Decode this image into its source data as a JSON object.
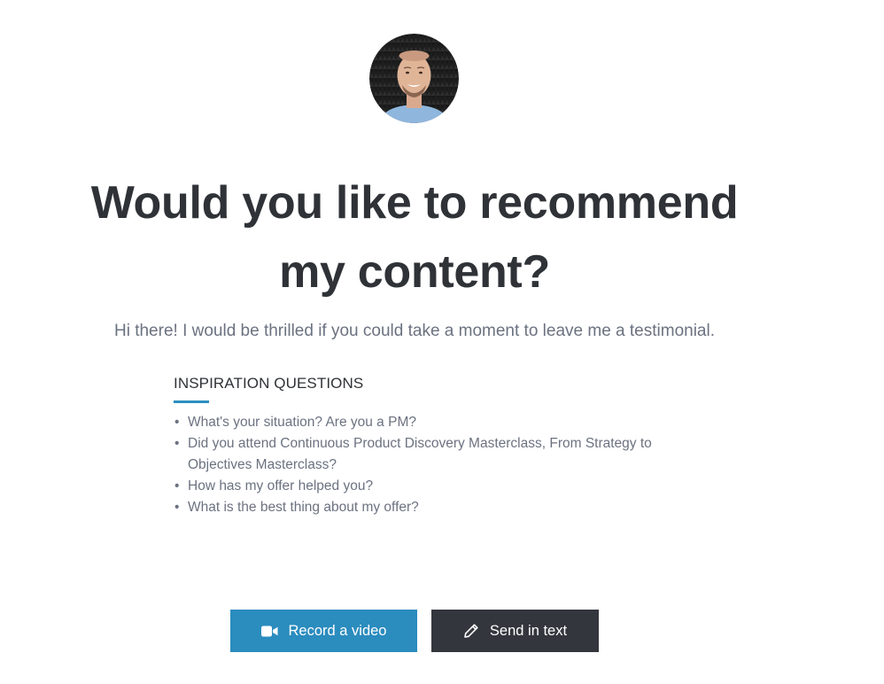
{
  "header": {
    "title_line1": "Would you like to recommend",
    "title_line2": "my content?",
    "subtitle": "Hi there! I would be thrilled if you could take a moment to leave me a testimonial."
  },
  "inspiration": {
    "heading": "INSPIRATION QUESTIONS",
    "questions": [
      "What's your situation? Are you a PM?",
      "Did you attend Continuous Product Discovery Masterclass, From Strategy to Objectives Masterclass?",
      "How has my offer helped you?",
      "What is the best thing about my offer?"
    ]
  },
  "actions": {
    "record_video_label": "Record a video",
    "send_text_label": "Send in text"
  },
  "icons": {
    "record": "video-camera-icon",
    "send": "pencil-icon"
  },
  "colors": {
    "accent": "#2b8cbe",
    "dark_button": "#33363d",
    "title": "#2f3237",
    "muted_text": "#6b7280"
  }
}
